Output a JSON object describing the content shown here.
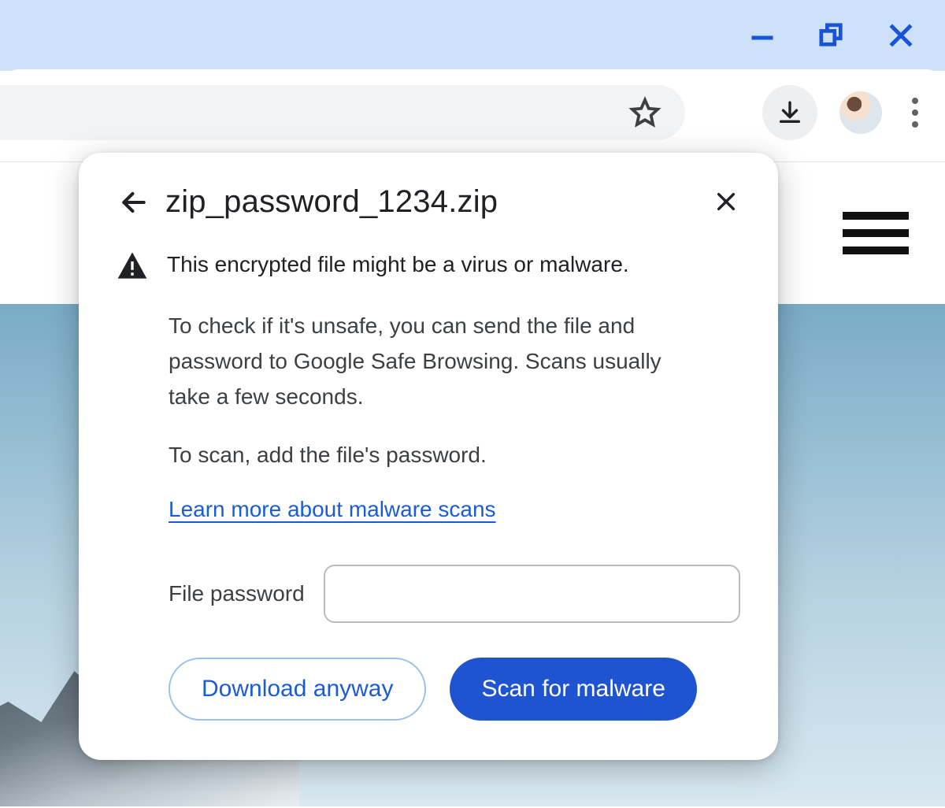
{
  "window_controls": {
    "minimize": "minimize",
    "restore": "restore",
    "close": "close"
  },
  "toolbar": {
    "bookmark": "bookmark",
    "downloads": "downloads",
    "profile": "profile",
    "menu": "menu"
  },
  "page": {
    "hamburger": "page-menu"
  },
  "dialog": {
    "back": "back",
    "title": "zip_password_1234.zip",
    "close": "close",
    "warning_line": "This encrypted file might be a virus or malware.",
    "info_para": "To check if it's unsafe, you can send the file and password to Google Safe Browsing. Scans usually take a few seconds.",
    "scan_prompt": "To scan, add the file's password.",
    "learn_more": "Learn more about malware scans",
    "password_label": "File password",
    "password_value": "",
    "buttons": {
      "download_anyway": "Download anyway",
      "scan": "Scan for malware"
    }
  },
  "colors": {
    "titlebar_bg": "#cee1fa",
    "accent_blue": "#1a5cd6",
    "primary_button": "#1f54d1",
    "window_control_blue": "#1754d8",
    "text_primary": "#202124",
    "text_secondary": "#3c4043",
    "border_grey": "#b9bdc1"
  }
}
